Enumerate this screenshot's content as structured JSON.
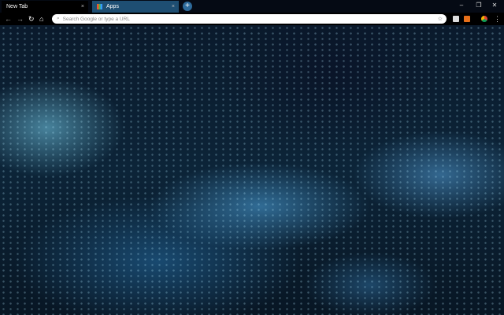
{
  "tabs": [
    {
      "label": "New Tab",
      "close": "×"
    },
    {
      "label": "Apps",
      "close": "×"
    }
  ],
  "new_tab": "+",
  "window_controls": {
    "minimize": "–",
    "restore": "❐",
    "close": "✕"
  },
  "nav": {
    "back": "←",
    "forward": "→",
    "reload": "↻",
    "home": "⌂"
  },
  "omnibox": {
    "placeholder": "Search Google or type a URL",
    "star": "☆"
  },
  "menu": "⋮"
}
